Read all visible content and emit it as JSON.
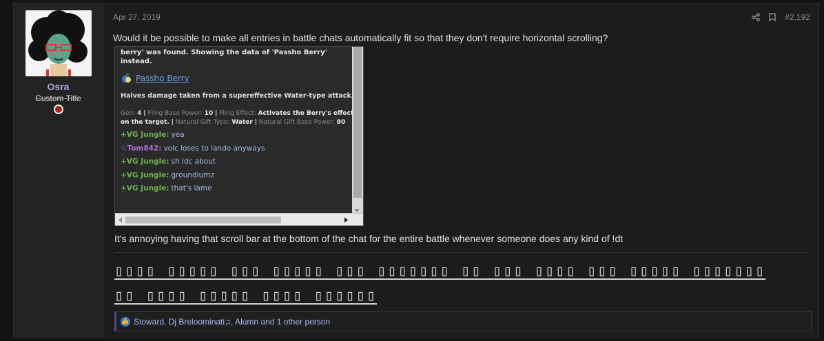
{
  "user": {
    "name": "Osra",
    "title": "Custom Title"
  },
  "post": {
    "date": "Apr 27, 2019",
    "number": "#2,192",
    "text1": "Would it be possible to make all entries in battle chats automatically fit so that they don't require horizontal scrolling?",
    "text2": "It's annoying having that scroll bar at the bottom of the chat for the entire battle whenever someone does any kind of !dt"
  },
  "chat": {
    "intro_line1": "berry' was found. Showing the data of 'Passho Berry'",
    "intro_line2": "instead.",
    "item_name": "Passho Berry",
    "description": "Halves damage taken from a supereffective Water-type attack.",
    "stats": {
      "gen_label": "Gen:",
      "gen_value": "4",
      "fling_power_label": "Fling Base Power:",
      "fling_power_value": "10",
      "fling_effect_label": "Fling Effect:",
      "fling_effect_value": "Activates the Berry's effect on the target.",
      "gift_type_label": "Natural Gift Type:",
      "gift_type_value": "Water",
      "gift_power_label": "Natural Gift Base Power:",
      "gift_power_value": "80"
    },
    "messages": [
      {
        "user": "+VG Jungle:",
        "text": "yea",
        "color": "green"
      },
      {
        "user": "☆Tom842:",
        "text": "volc loses to lando anyways",
        "color": "purple"
      },
      {
        "user": "+VG Jungle:",
        "text": "sh idc about",
        "color": "green"
      },
      {
        "user": "+VG Jungle:",
        "text": "groundiumz",
        "color": "green"
      },
      {
        "user": "+VG Jungle:",
        "text": "that's lame",
        "color": "green"
      }
    ]
  },
  "signature": "▯▯▯▯ ▯▯▯▯▯ ▯▯▯ ▯▯▯▯▯ ▯▯▯ ▯▯▯▯▯▯▯ ▯▯ ▯▯▯ ▯▯▯▯ ▯▯▯ ▯▯▯▯▯ ▯▯▯▯▯▯▯ ▯▯ ▯▯▯▯ ▯▯▯▯▯ ▯▯▯▯ ▯▯▯▯▯▯",
  "reactions": {
    "text": "Stoward, Dj Breloominati♫, Alumn and 1 other person"
  },
  "colors": {
    "accent": "#b7a3e0",
    "link": "#6a9ff0",
    "chat_green": "#6fb04d",
    "chat_purple": "#b26cd0"
  }
}
